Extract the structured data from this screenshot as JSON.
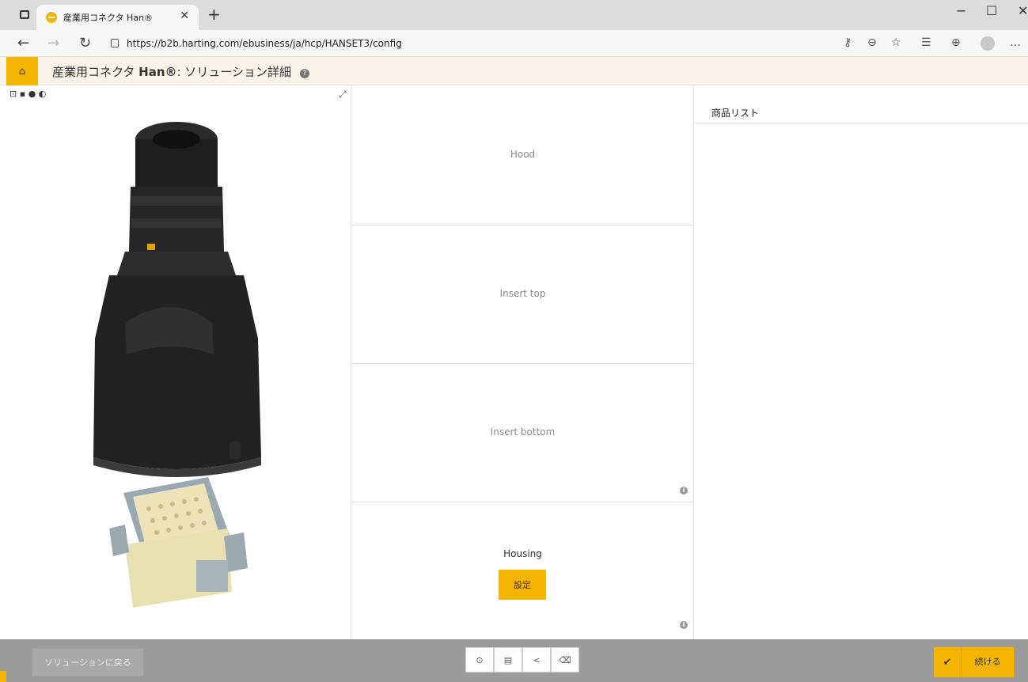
{
  "browser": {
    "tab_title": "産業用コネクタ Han®",
    "url": "https://b2b.harting.com/ebusiness/ja/hcp/HANSET3/config"
  },
  "header": {
    "title_prefix": "産業用コネクタ ",
    "title_brand": "Han®",
    "title_suffix": ": ソリューション詳細"
  },
  "config": {
    "slots": [
      {
        "label": "Hood"
      },
      {
        "label": "Insert top"
      },
      {
        "label": "Insert bottom"
      },
      {
        "label": "Housing"
      }
    ],
    "set_button": "設定"
  },
  "product_list": {
    "title": "商品リスト"
  },
  "footer": {
    "back_button": "ソリューションに戻る",
    "continue_button": "続ける"
  },
  "colors": {
    "accent": "#f5b400",
    "bottom_bar": "#9b9b9b"
  },
  "icons": [
    "home-icon",
    "help-icon",
    "info-icon",
    "upload-icon",
    "save-icon",
    "share-icon",
    "delete-icon",
    "check-icon"
  ]
}
